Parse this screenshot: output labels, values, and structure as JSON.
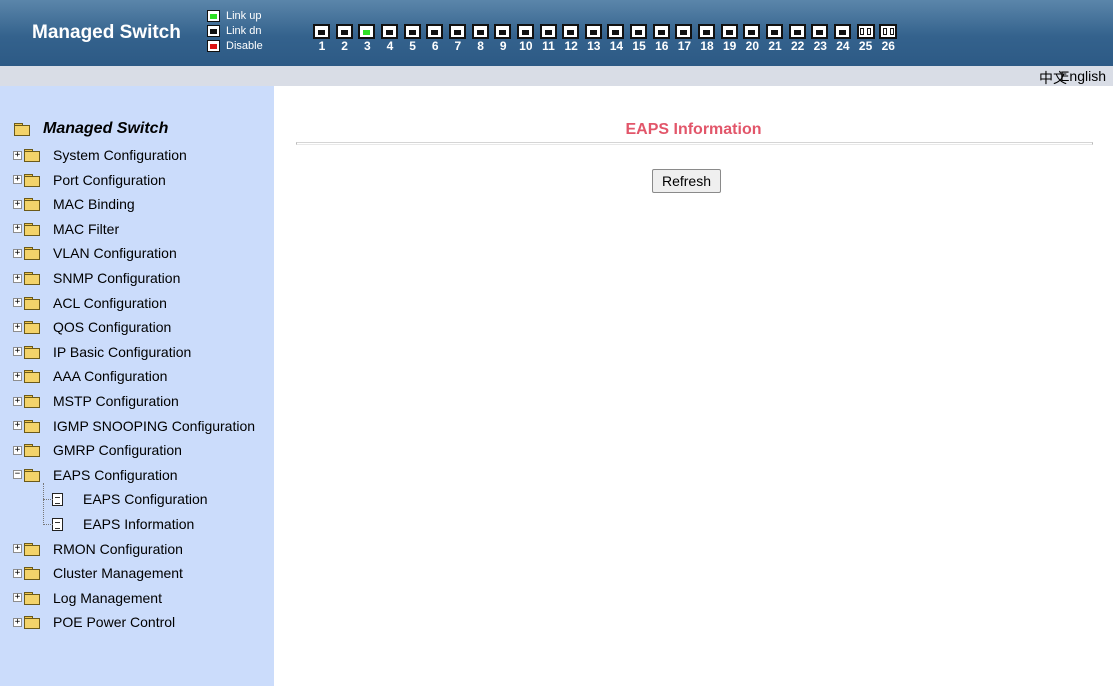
{
  "header": {
    "title": "Managed Switch",
    "legend": {
      "link_up": "Link up",
      "link_dn": "Link dn",
      "disable": "Disable"
    },
    "ports": [
      {
        "num": "1",
        "status": "down"
      },
      {
        "num": "2",
        "status": "down"
      },
      {
        "num": "3",
        "status": "up"
      },
      {
        "num": "4",
        "status": "down"
      },
      {
        "num": "5",
        "status": "down"
      },
      {
        "num": "6",
        "status": "down"
      },
      {
        "num": "7",
        "status": "down"
      },
      {
        "num": "8",
        "status": "down"
      },
      {
        "num": "9",
        "status": "down"
      },
      {
        "num": "10",
        "status": "down"
      },
      {
        "num": "11",
        "status": "down"
      },
      {
        "num": "12",
        "status": "down"
      },
      {
        "num": "13",
        "status": "down"
      },
      {
        "num": "14",
        "status": "down"
      },
      {
        "num": "15",
        "status": "down"
      },
      {
        "num": "16",
        "status": "down"
      },
      {
        "num": "17",
        "status": "down"
      },
      {
        "num": "18",
        "status": "down"
      },
      {
        "num": "19",
        "status": "down"
      },
      {
        "num": "20",
        "status": "down"
      },
      {
        "num": "21",
        "status": "down"
      },
      {
        "num": "22",
        "status": "down"
      },
      {
        "num": "23",
        "status": "down"
      },
      {
        "num": "24",
        "status": "down"
      },
      {
        "num": "25",
        "status": "fiber"
      },
      {
        "num": "26",
        "status": "fiber"
      }
    ]
  },
  "langbar": {
    "chinese": "中文",
    "english": "English"
  },
  "sidebar": {
    "root": "Managed Switch",
    "items": [
      {
        "label": "System Configuration",
        "expanded": false
      },
      {
        "label": "Port Configuration",
        "expanded": false
      },
      {
        "label": "MAC Binding",
        "expanded": false
      },
      {
        "label": "MAC Filter",
        "expanded": false
      },
      {
        "label": "VLAN Configuration",
        "expanded": false
      },
      {
        "label": "SNMP Configuration",
        "expanded": false
      },
      {
        "label": "ACL Configuration",
        "expanded": false
      },
      {
        "label": "QOS Configuration",
        "expanded": false
      },
      {
        "label": "IP Basic Configuration",
        "expanded": false
      },
      {
        "label": "AAA Configuration",
        "expanded": false
      },
      {
        "label": "MSTP Configuration",
        "expanded": false
      },
      {
        "label": "IGMP SNOOPING Configuration",
        "expanded": false
      },
      {
        "label": "GMRP Configuration",
        "expanded": false
      },
      {
        "label": "EAPS Configuration",
        "expanded": true
      },
      {
        "label": "RMON Configuration",
        "expanded": false
      },
      {
        "label": "Cluster Management",
        "expanded": false
      },
      {
        "label": "Log Management",
        "expanded": false
      },
      {
        "label": "POE Power Control",
        "expanded": false
      }
    ],
    "eaps_children": [
      {
        "label": "EAPS Configuration"
      },
      {
        "label": "EAPS Information"
      }
    ]
  },
  "main": {
    "title": "EAPS Information",
    "refresh_label": "Refresh"
  },
  "colors": {
    "header_bg": "#34628d",
    "sidebar_bg": "#cbdcfb",
    "title_color": "#e2566a",
    "link_up": "#2ee024",
    "disable": "#dd1414"
  }
}
